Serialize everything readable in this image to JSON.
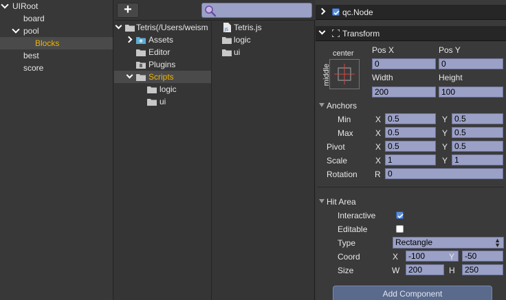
{
  "hierarchy": {
    "items": [
      {
        "label": "UIRoot",
        "expanded": true
      },
      {
        "label": "board"
      },
      {
        "label": "pool",
        "expanded": true
      },
      {
        "label": "Blocks",
        "selected": true
      },
      {
        "label": "best"
      },
      {
        "label": "score"
      }
    ]
  },
  "project": {
    "add_label": "+",
    "search": {
      "value": ""
    },
    "tree": [
      {
        "label": "Tetris(/Users/weism"
      },
      {
        "label": "Assets"
      },
      {
        "label": "Editor"
      },
      {
        "label": "Plugins"
      },
      {
        "label": "Scripts",
        "selected": true
      },
      {
        "label": "logic"
      },
      {
        "label": "ui"
      }
    ],
    "files": [
      {
        "label": "Tetris.js",
        "icon": "js-file-icon"
      },
      {
        "label": "logic",
        "icon": "folder-icon"
      },
      {
        "label": "ui",
        "icon": "folder-icon"
      }
    ]
  },
  "inspector": {
    "node": {
      "label": "qc.Node",
      "enabled": true
    },
    "transform": {
      "title": "Transform",
      "anchor_h": "center",
      "anchor_v": "middle",
      "posx_label": "Pos X",
      "posy_label": "Pos Y",
      "posx": "0",
      "posy": "0",
      "width_label": "Width",
      "height_label": "Height",
      "width": "200",
      "height": "100",
      "anchors_label": "Anchors",
      "min_label": "Min",
      "max_label": "Max",
      "x_label": "X",
      "y_label": "Y",
      "min_x": "0.5",
      "min_y": "0.5",
      "max_x": "0.5",
      "max_y": "0.5",
      "pivot_label": "Pivot",
      "pivot_x": "0.5",
      "pivot_y": "0.5",
      "scale_label": "Scale",
      "scale_x": "1",
      "scale_y": "1",
      "rotation_label": "Rotation",
      "r_label": "R",
      "rotation": "0"
    },
    "hit_area": {
      "title": "Hit Area",
      "interactive_label": "Interactive",
      "interactive": true,
      "editable_label": "Editable",
      "editable": false,
      "type_label": "Type",
      "type_value": "Rectangle",
      "coord_label": "Coord",
      "coord_x_label": "X",
      "coord_y_label": "Y",
      "coord_x": "-100",
      "coord_y": "-50",
      "size_label": "Size",
      "w_label": "W",
      "h_label": "H",
      "size_w": "200",
      "size_h": "250"
    },
    "add_component_label": "Add Component"
  },
  "colors": {
    "selected_text": "#f0b400",
    "input_bg": "#9aa0c6",
    "checkbox_on": "#5b8ed8",
    "panel_bg": "#383838"
  }
}
